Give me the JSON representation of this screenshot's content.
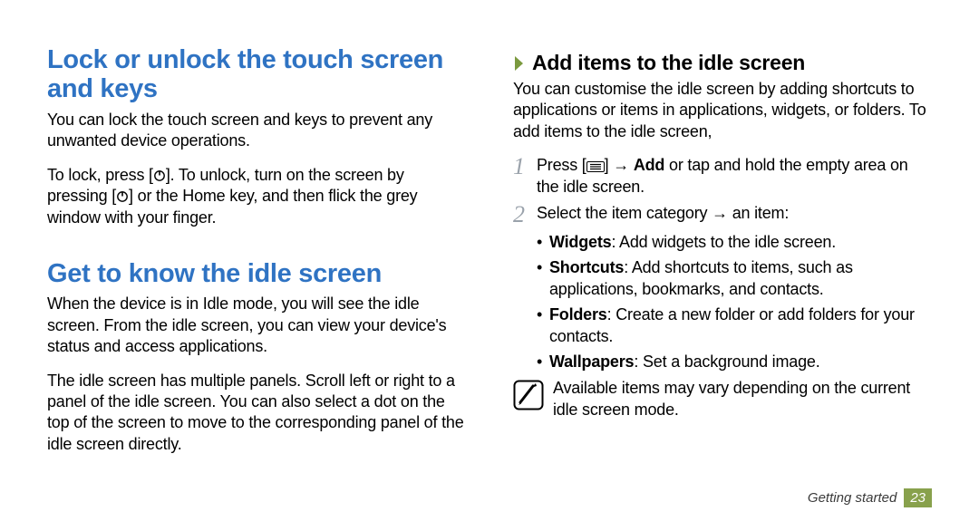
{
  "left": {
    "h1a": "Lock or unlock the touch screen and keys",
    "p1": "You can lock the touch screen and keys to prevent any unwanted device operations.",
    "p2_pre": "To lock, press [",
    "p2_mid1": "]. To unlock, turn on the screen by pressing [",
    "p2_mid2": "] or the Home key, and then flick the grey window with your finger.",
    "h1b": "Get to know the idle screen",
    "p3": "When the device is in Idle mode, you will see the idle screen. From the idle screen, you can view your device's status and access applications.",
    "p4": "The idle screen has multiple panels. Scroll left or right to a panel of the idle screen. You can also select a dot on the top of the screen to move to the corresponding panel of the idle screen directly."
  },
  "right": {
    "sub": "Add items to the idle screen",
    "intro": "You can customise the idle screen by adding shortcuts to applications or items in applications, widgets, or folders. To add items to the idle screen,",
    "step1_pre": "Press [",
    "step1_mid": "] → ",
    "step1_bold": "Add",
    "step1_post": " or tap and hold the empty area on the idle screen.",
    "step2": "Select the item category → an item:",
    "bullets": {
      "widgets_b": "Widgets",
      "widgets_t": ": Add widgets to the idle screen.",
      "shortcuts_b": "Shortcuts",
      "shortcuts_t": ": Add shortcuts to items, such as applications, bookmarks, and contacts.",
      "folders_b": "Folders",
      "folders_t": ": Create a new folder or add folders for your contacts.",
      "wallpapers_b": "Wallpapers",
      "wallpapers_t": ": Set a background image."
    },
    "note": "Available items may vary depending on the current idle screen mode."
  },
  "footer": {
    "chapter": "Getting started",
    "page": "23"
  },
  "steps": {
    "one": "1",
    "two": "2"
  }
}
